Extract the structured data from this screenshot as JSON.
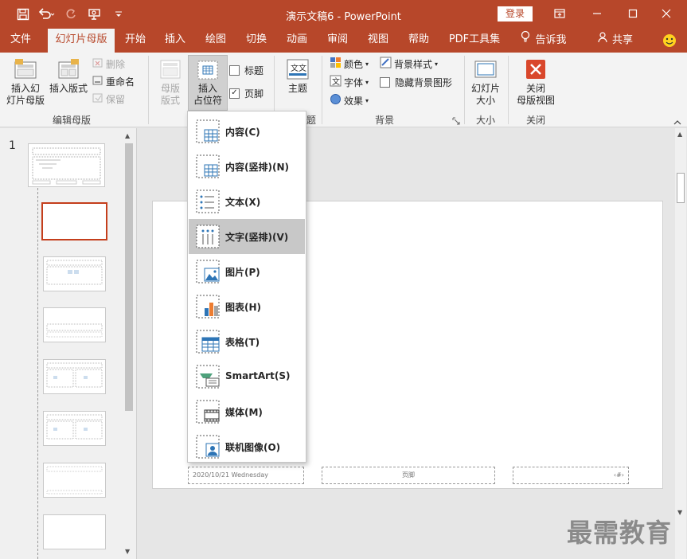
{
  "titlebar": {
    "title": "演示文稿6  -  PowerPoint",
    "login": "登录"
  },
  "tabs": [
    "文件",
    "幻灯片母版",
    "开始",
    "插入",
    "绘图",
    "切换",
    "动画",
    "审阅",
    "视图",
    "帮助",
    "PDF工具集",
    "告诉我",
    "共享"
  ],
  "ribbon": {
    "insert_slide_master": "插入幻\n灯片母版",
    "insert_layout": "插入版式",
    "delete": "删除",
    "rename": "重命名",
    "preserve": "保留",
    "group_edit_master": "编辑母版",
    "master_layout": "母版\n版式",
    "insert_placeholder": "插入\n占位符",
    "title_check": "标题",
    "footer_check": "页脚",
    "theme": "主题",
    "group_theme_partial": "题",
    "colors": "颜色",
    "fonts": "字体",
    "effects": "效果",
    "bg_styles": "背景样式",
    "hide_bg": "隐藏背景图形",
    "group_background": "背景",
    "slide_size": "幻灯片\n大小",
    "group_size": "大小",
    "close_master": "关闭\n母版视图",
    "group_close": "关闭"
  },
  "thumbpane": {
    "slide_number": "1"
  },
  "slide": {
    "footer_date": "2020/10/21 Wednesday",
    "footer_center": "页脚",
    "footer_number": "‹#›"
  },
  "dropdown": [
    {
      "label": "内容(C)",
      "icon": "content-icon"
    },
    {
      "label": "内容(竖排)(N)",
      "icon": "content-vertical-icon"
    },
    {
      "label": "文本(X)",
      "icon": "text-icon"
    },
    {
      "label": "文字(竖排)(V)",
      "icon": "text-vertical-icon"
    },
    {
      "label": "图片(P)",
      "icon": "picture-icon"
    },
    {
      "label": "图表(H)",
      "icon": "chart-icon"
    },
    {
      "label": "表格(T)",
      "icon": "table-icon"
    },
    {
      "label": "SmartArt(S)",
      "icon": "smartart-icon"
    },
    {
      "label": "媒体(M)",
      "icon": "media-icon"
    },
    {
      "label": "联机图像(O)",
      "icon": "online-image-icon"
    }
  ],
  "watermark": "最需教育",
  "colors": {
    "accent": "#b7472a",
    "selected_border": "#c43e1c",
    "hover": "#c8c8c8"
  }
}
